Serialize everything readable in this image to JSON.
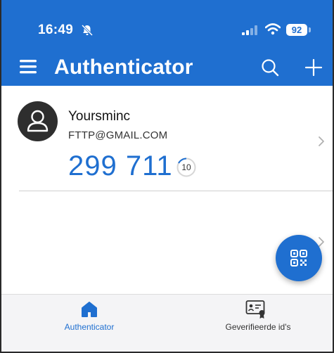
{
  "status_bar": {
    "time": "16:49",
    "battery": "92",
    "icons": [
      "bell-slash-icon",
      "signal-icon",
      "wifi-icon",
      "battery-icon"
    ]
  },
  "header": {
    "title": "Authenticator",
    "icons": [
      "menu-icon",
      "search-icon",
      "add-icon"
    ]
  },
  "account": {
    "name": "Yoursminc",
    "email": "FTTP@GMAIL.COM",
    "code": "299 711",
    "seconds_remaining": "10"
  },
  "fab": {
    "icon": "qr-code-icon"
  },
  "tabs": [
    {
      "label": "Authenticator",
      "icon": "home-icon",
      "active": true
    },
    {
      "label": "Geverifieerde id's",
      "icon": "id-card-icon",
      "active": false
    }
  ],
  "colors": {
    "primary": "#1f6fd0",
    "text_dark": "#111111",
    "tab_bar_bg": "#f4f4f6"
  }
}
